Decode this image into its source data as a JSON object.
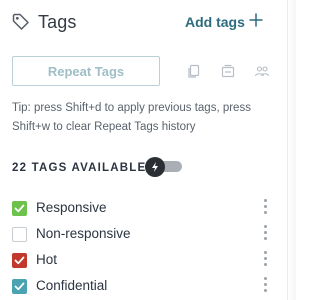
{
  "header": {
    "title": "Tags",
    "title_icon": "tag-icon",
    "add_label": "Add tags",
    "add_icon": "plus-icon"
  },
  "repeat": {
    "button_label": "Repeat Tags",
    "icons": [
      "copy-icon",
      "stack-icon",
      "users-icon"
    ]
  },
  "tip": "Tip: press Shift+d to apply previous tags, press Shift+w to clear Repeat Tags history",
  "available": {
    "label": "22 TAGS AVAILABLE",
    "toggle_icon": "lightning-icon",
    "toggle_on": false
  },
  "tags": [
    {
      "label": "Responsive",
      "checked": true,
      "color": "#6cc24a"
    },
    {
      "label": "Non-responsive",
      "checked": false,
      "color": "#ffffff"
    },
    {
      "label": "Hot",
      "checked": true,
      "color": "#c0392b"
    },
    {
      "label": "Confidential",
      "checked": true,
      "color": "#4aa3b0"
    }
  ],
  "colors": {
    "accent": "#2d6c7f",
    "button_text_disabled": "#9fbec6",
    "button_border": "#b9d0d6"
  }
}
